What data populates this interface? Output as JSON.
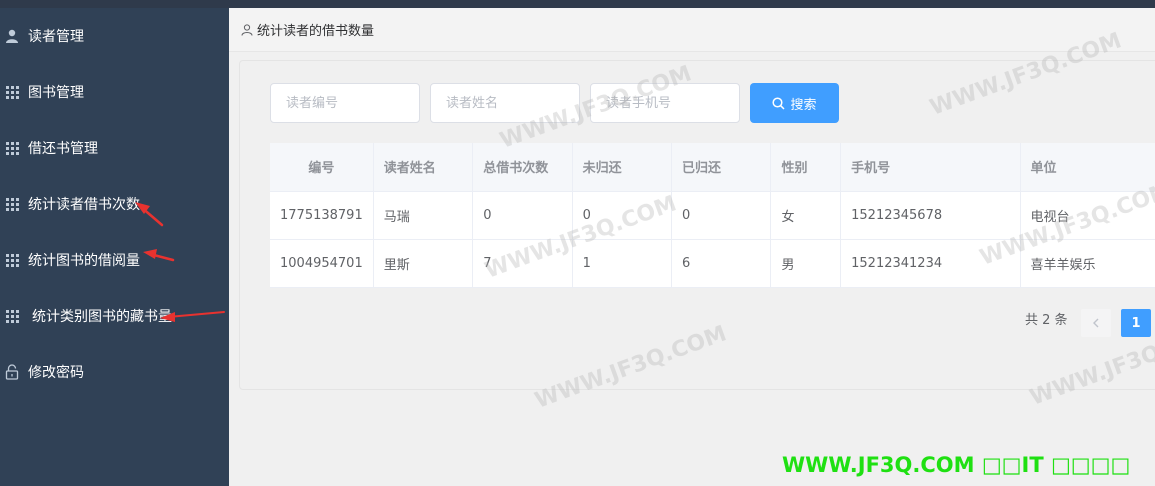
{
  "sidebar": {
    "items": [
      {
        "label": "读者管理",
        "icon": "user-icon"
      },
      {
        "label": "图书管理",
        "icon": "grid-icon"
      },
      {
        "label": "借还书管理",
        "icon": "grid-icon"
      },
      {
        "label": "统计读者借书次数",
        "icon": "grid-icon"
      },
      {
        "label": "统计图书的借阅量",
        "icon": "grid-icon"
      },
      {
        "label": "统计类别图书的藏书量",
        "icon": "grid-icon"
      },
      {
        "label": "修改密码",
        "icon": "lock-icon"
      }
    ]
  },
  "breadcrumb": {
    "title": "统计读者的借书数量",
    "icon": "user-icon"
  },
  "search": {
    "reader_id_placeholder": "读者编号",
    "reader_name_placeholder": "读者姓名",
    "phone_placeholder": "读者手机号",
    "button_label": "搜索"
  },
  "table": {
    "headers": [
      "编号",
      "读者姓名",
      "总借书次数",
      "未归还",
      "已归还",
      "性别",
      "手机号",
      "单位"
    ],
    "rows": [
      [
        "1775138791",
        "马瑞",
        "0",
        "0",
        "0",
        "女",
        "15212345678",
        "电视台"
      ],
      [
        "1004954701",
        "里斯",
        "7",
        "1",
        "6",
        "男",
        "15212341234",
        "喜羊羊娱乐"
      ]
    ]
  },
  "pagination": {
    "total_text": "共 2 条",
    "prev_icon": "chevron-left-icon",
    "current_page": "1"
  },
  "watermark": {
    "text": "WWW.JF3Q.COM",
    "footer_text": "WWW.JF3Q.COM □□IT □□□□"
  },
  "colors": {
    "sidebar": "#304156",
    "accent": "#409eff",
    "annotation_arrow": "#e8322f",
    "footer_watermark": "#1fe012"
  }
}
